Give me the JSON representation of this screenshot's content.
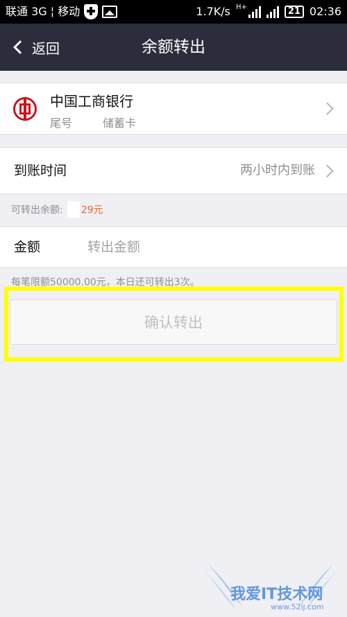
{
  "status_bar": {
    "carrier": "联通 3G ¦ 移动",
    "network_speed": "1.7K/s",
    "network_type": "H+",
    "battery": "21",
    "time": "02:36"
  },
  "nav": {
    "back_label": "返回",
    "title": "余额转出"
  },
  "bank_card": {
    "name": "中国工商银行",
    "tail_label": "尾号",
    "card_type": "储蓄卡"
  },
  "arrival": {
    "label": "到账时间",
    "value": "两小时内到账"
  },
  "balance": {
    "label": "可转出余额:",
    "amount": "29元"
  },
  "amount": {
    "label": "金额",
    "placeholder": "转出金额",
    "value": ""
  },
  "limit_text": "每笔限额50000.00元，本日还可转出3次。",
  "confirm_label": "确认转出",
  "watermark": {
    "text": "我爱IT技术网",
    "url": "www.52ij.com"
  },
  "colors": {
    "nav_bg": "#2b2d3c",
    "page_bg": "#efeff4",
    "highlight": "#ffff00",
    "balance_amount": "#e8692c",
    "bank_brand": "#c9141c"
  }
}
